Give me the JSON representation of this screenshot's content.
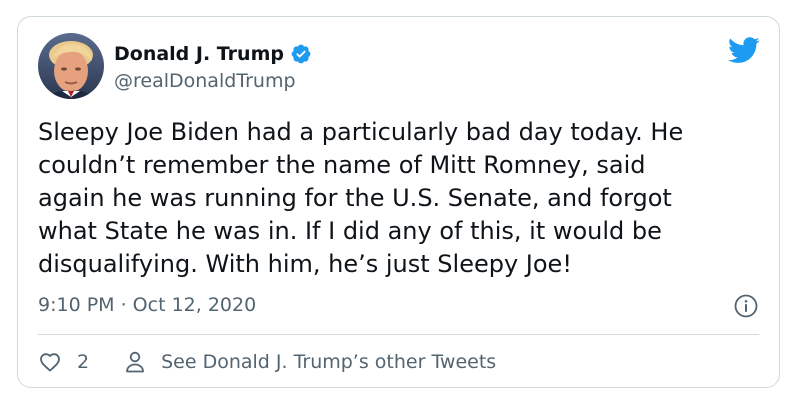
{
  "user": {
    "display_name": "Donald J. Trump",
    "handle": "@realDonaldTrump",
    "verified": true
  },
  "tweet": {
    "text": "Sleepy Joe Biden had a particularly bad day today. He\ncouldn’t remember the name of Mitt Romney, said\nagain he was running for the U.S. Senate, and forgot\nwhat State he was in. If I did any of this, it would be\ndisqualifying. With him, he’s just Sleepy Joe!",
    "timestamp": "9:10 PM · Oct 12, 2020"
  },
  "actions": {
    "like_count": "2",
    "profile_link_label": "See Donald J. Trump’s other Tweets"
  },
  "icons": {
    "brand": "twitter-bird-icon",
    "verified": "verified-badge-icon",
    "info": "info-icon",
    "like": "heart-icon",
    "profile": "person-icon"
  },
  "colors": {
    "brand_blue": "#1d9bf0",
    "text_primary": "#0f1419",
    "text_secondary": "#536471",
    "border": "#cfd9de"
  }
}
